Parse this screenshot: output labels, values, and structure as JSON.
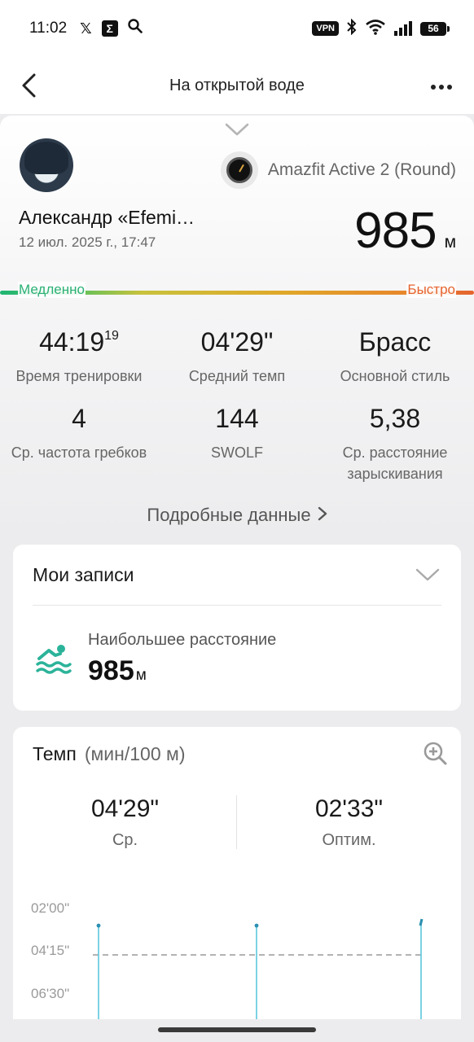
{
  "status_bar": {
    "time": "11:02",
    "icons": [
      "x-icon",
      "sigma-icon",
      "search-icon"
    ],
    "vpn_label": "VPN",
    "battery": "56"
  },
  "app_bar": {
    "title": "На открытой воде",
    "more_icon": "more-dots-icon"
  },
  "workout": {
    "user_name": "Александр «Efemi…",
    "datetime": "12 июл. 2025 г., 17:47",
    "device": "Amazfit Active 2 (Round)",
    "distance_value": "985",
    "distance_unit": "м",
    "pace_scale": {
      "slow": "Медленно",
      "fast": "Быстро"
    }
  },
  "stats": [
    {
      "value": "44:19",
      "sup": "19",
      "label": "Время тренировки"
    },
    {
      "value": "04'29\"",
      "label": "Средний темп"
    },
    {
      "value": "Брасс",
      "label": "Основной стиль"
    },
    {
      "value": "4",
      "label": "Ср. частота гребков"
    },
    {
      "value": "144",
      "label": "SWOLF"
    },
    {
      "value": "5,38",
      "label": "Ср. расстояние зарыскивания"
    }
  ],
  "details_link": "Подробные данные",
  "records_card": {
    "title": "Мои записи",
    "record_label": "Наибольшее расстояние",
    "record_value": "985",
    "record_unit": "м"
  },
  "pace_card": {
    "title": "Темп",
    "unit": "(мин/100 м)",
    "avg_value": "04'29\"",
    "avg_label": "Ср.",
    "best_value": "02'33\"",
    "best_label": "Оптим.",
    "y_ticks": [
      "02'00\"",
      "04'15\"",
      "06'30\""
    ]
  },
  "colors": {
    "slow": "#2ab174",
    "fast": "#e5642e",
    "accent_teal": "#2bb39a",
    "chart_line": "#5bc6de"
  }
}
